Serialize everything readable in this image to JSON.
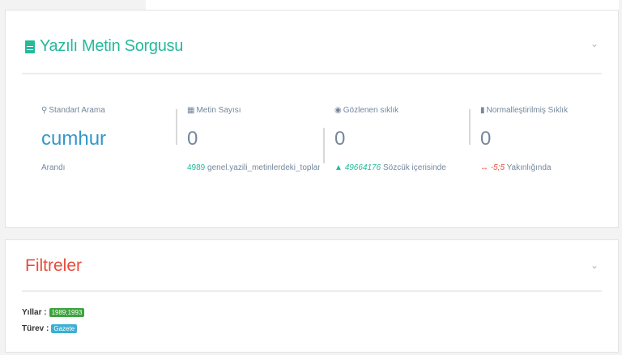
{
  "query_panel": {
    "title": "Yazılı Metin Sorgusu",
    "collapse_icon": "chevron-down-icon",
    "stats": [
      {
        "icon": "search-icon",
        "label": "Standart Arama",
        "value": "cumhur",
        "sub": "Arandı"
      },
      {
        "icon": "file-icon",
        "label": "Metin Sayısı",
        "value": "0",
        "sub_value": "4989",
        "sub_text": " genel.yazili_metinlerdeki_toplam_s"
      },
      {
        "icon": "eye-icon",
        "label": "Gözlenen sıklık",
        "value": "0",
        "sub_value": "49664176",
        "sub_text": " Sözcük içerisinde"
      },
      {
        "icon": "bars-icon",
        "label": "Normalleştirilmiş Sıklık",
        "value": "0",
        "sub_value": "-5;5",
        "sub_text": " Yakınlığında"
      }
    ]
  },
  "filters_panel": {
    "title": "Filtreler",
    "collapse_icon": "chevron-down-icon",
    "rows": [
      {
        "label": "Yıllar :",
        "tag": "1989;1993"
      },
      {
        "label": "Türev :",
        "tag": "Gazete"
      }
    ]
  },
  "colors": {
    "accent": "#26b99a",
    "value_blue": "#3497c9",
    "danger": "#e74c3c",
    "muted": "#73879c"
  }
}
